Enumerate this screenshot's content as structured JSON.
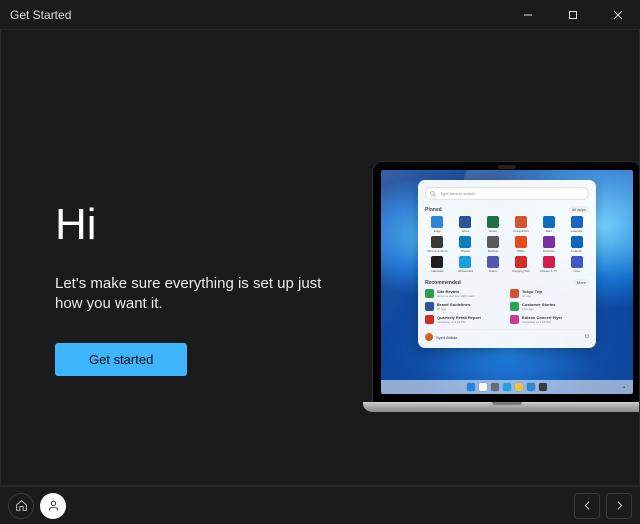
{
  "window": {
    "title": "Get Started"
  },
  "hero": {
    "title": "Hi",
    "subtitle": "Let's make sure everything is set up just how you want it.",
    "button_label": "Get started"
  },
  "laptop": {
    "start_menu": {
      "search_placeholder": "Type here to search",
      "pinned_label": "Pinned",
      "all_apps_label": "All apps",
      "recommended_label": "Recommended",
      "more_label": "More",
      "pinned_apps": [
        {
          "name": "Edge",
          "color": "#2f86d7"
        },
        {
          "name": "Word",
          "color": "#2a5699"
        },
        {
          "name": "Excel",
          "color": "#1e7145"
        },
        {
          "name": "PowerPoint",
          "color": "#d35230"
        },
        {
          "name": "Mail",
          "color": "#0f6cbd"
        },
        {
          "name": "Calendar",
          "color": "#1b63c4"
        },
        {
          "name": "Microsoft Store",
          "color": "#3a3a3a"
        },
        {
          "name": "Photos",
          "color": "#0d7fc0"
        },
        {
          "name": "Settings",
          "color": "#5b5b5b"
        },
        {
          "name": "Office",
          "color": "#e64a19"
        },
        {
          "name": "OneNote",
          "color": "#7b2fa1"
        },
        {
          "name": "LinkedIn",
          "color": "#0a66c2"
        },
        {
          "name": "Calculator",
          "color": "#202020"
        },
        {
          "name": "Whiteboard",
          "color": "#1aa0e0"
        },
        {
          "name": "Teams",
          "color": "#5558af"
        },
        {
          "name": "Snipping Tool",
          "color": "#d42b2b"
        },
        {
          "name": "Movies & TV",
          "color": "#d01f4a"
        },
        {
          "name": "Chat",
          "color": "#4258c9"
        }
      ],
      "recommended": [
        {
          "title": "Site Review",
          "subtitle": "Here's a doc you might want",
          "color": "#2a9c4a"
        },
        {
          "title": "Tokyo Trip",
          "subtitle": "1h ago",
          "color": "#d35230"
        },
        {
          "title": "Brand Guidelines",
          "subtitle": "2h ago",
          "color": "#2a5699"
        },
        {
          "title": "Customer Stories",
          "subtitle": "12m ago",
          "color": "#2aa358"
        },
        {
          "title": "Quarterly Retail Report",
          "subtitle": "Yesterday at 4:25 PM",
          "color": "#d42b2b"
        },
        {
          "title": "Edison Concert Flyer",
          "subtitle": "Yesterday at 1:15 PM",
          "color": "#c83c92"
        }
      ],
      "user_name": "Syed Abbas"
    },
    "taskbar_icons": [
      {
        "name": "start",
        "color": "#1e87e5"
      },
      {
        "name": "search",
        "color": "#ffffff"
      },
      {
        "name": "task-view",
        "color": "#6a6a6a"
      },
      {
        "name": "widgets",
        "color": "#1fa1df"
      },
      {
        "name": "explorer",
        "color": "#f0c23c"
      },
      {
        "name": "edge",
        "color": "#2f86d7"
      },
      {
        "name": "store",
        "color": "#3a3a3a"
      }
    ]
  },
  "colors": {
    "accent": "#3db5ff"
  }
}
